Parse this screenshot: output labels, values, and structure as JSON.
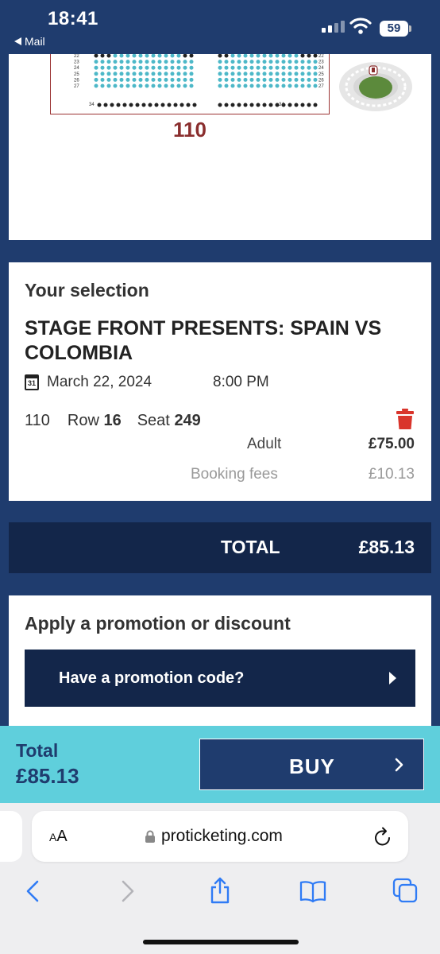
{
  "status": {
    "time": "18:41",
    "back_label": "Mail",
    "battery": "59"
  },
  "seatmap": {
    "rows_left": [
      "22",
      "23",
      "24",
      "25",
      "26",
      "27"
    ],
    "rows_right": [
      "22",
      "23",
      "24",
      "25",
      "26",
      "27"
    ],
    "bottom_row_left": "34",
    "bottom_row_right": "34",
    "section_label": "110"
  },
  "selection": {
    "heading": "Your selection",
    "event_title": "STAGE FRONT PRESENTS: SPAIN VS COLOMBIA",
    "date": "March 22, 2024",
    "calendar_day": "31",
    "time": "8:00 PM",
    "section": "110",
    "row_label": "Row",
    "row": "16",
    "seat_label": "Seat",
    "seat": "249",
    "ticket_type": "Adult",
    "ticket_price": "£75.00",
    "fees_label": "Booking fees",
    "fees_value": "£10.13"
  },
  "total": {
    "label": "TOTAL",
    "value": "£85.13"
  },
  "promo": {
    "heading": "Apply a promotion or discount",
    "button_label": "Have a promotion code?"
  },
  "buybar": {
    "total_label": "Total",
    "total_value": "£85.13",
    "buy_label": "BUY"
  },
  "browser": {
    "aa_big": "A",
    "aa_small": "A",
    "url": "proticketing.com"
  },
  "colors": {
    "navy": "#1f3c6e",
    "dark_navy": "#13264a",
    "cyan": "#5fcfdc",
    "seat_teal": "#4db8c8",
    "section_red": "#8a2e2e",
    "trash_red": "#d9342b"
  },
  "icons": [
    "back-triangle-icon",
    "signal-icon",
    "wifi-icon",
    "battery-icon",
    "calendar-icon",
    "trash-icon",
    "chevron-right-icon",
    "lock-icon",
    "reload-icon",
    "back-arrow-icon",
    "forward-arrow-icon",
    "share-icon",
    "bookmarks-icon",
    "tabs-icon"
  ]
}
